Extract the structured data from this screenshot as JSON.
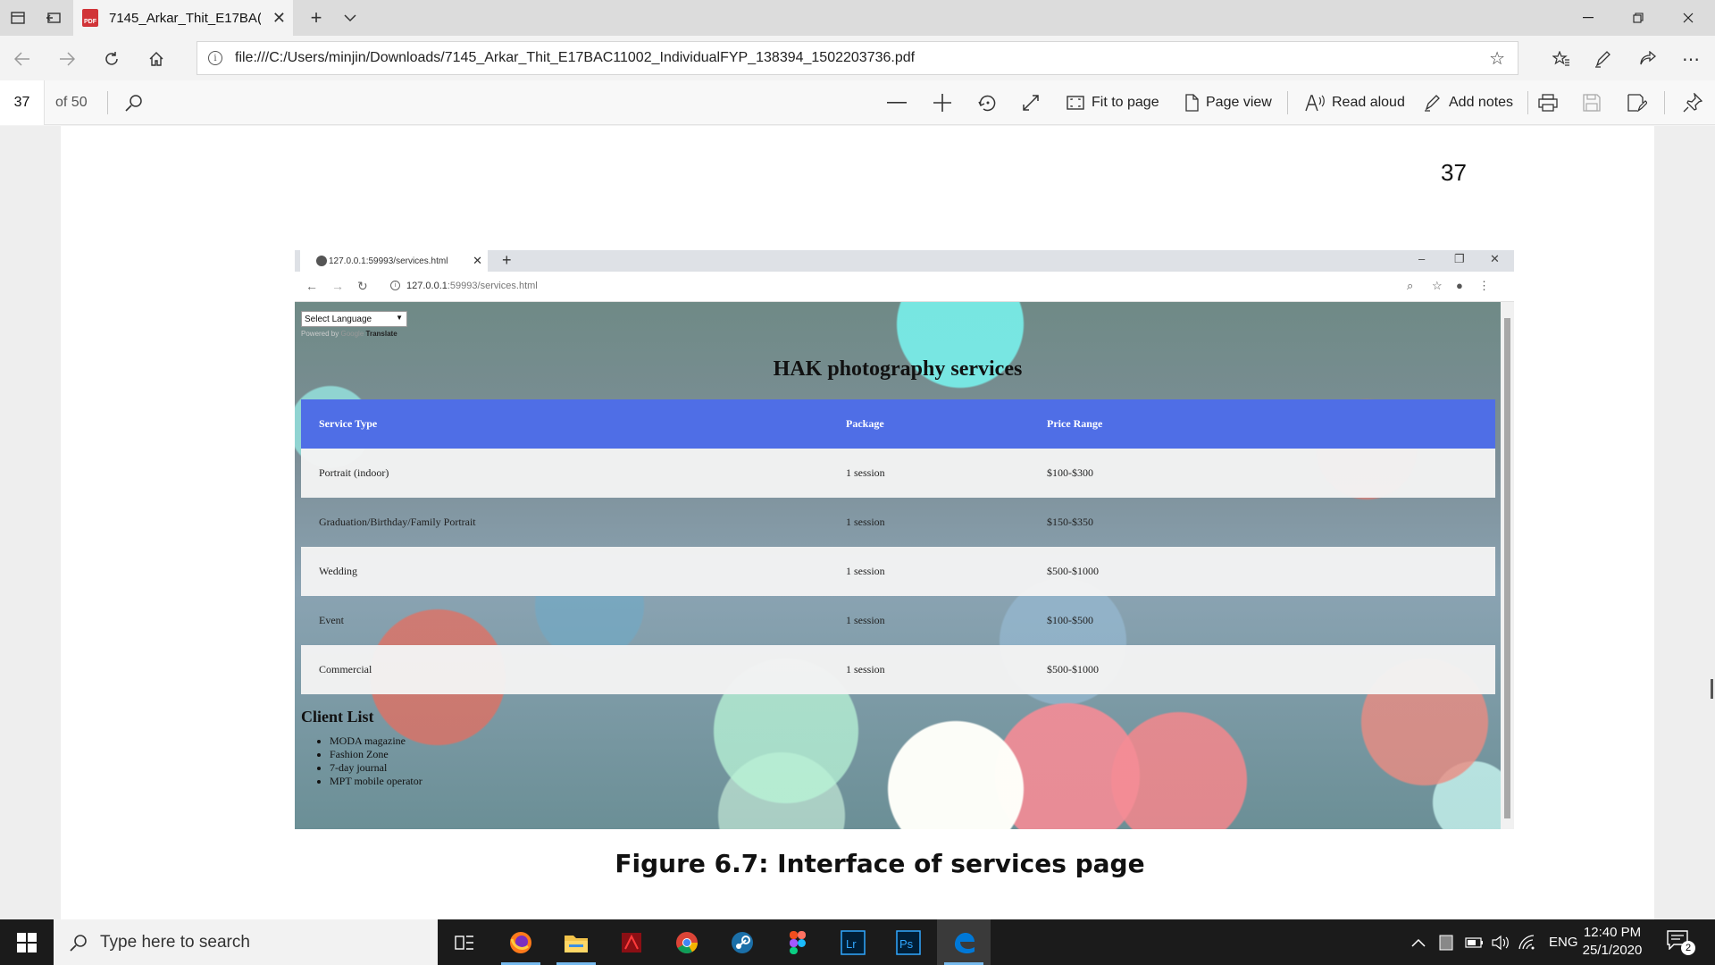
{
  "browser": {
    "tab_title": "7145_Arkar_Thit_E17BA(",
    "url": "file:///C:/Users/minjin/Downloads/7145_Arkar_Thit_E17BAC11002_IndividualFYP_138394_1502203736.pdf"
  },
  "pdf_toolbar": {
    "current_page": "37",
    "page_count": "of 50",
    "fit_to_page": "Fit to page",
    "page_view": "Page view",
    "read_aloud": "Read aloud",
    "add_notes": "Add notes"
  },
  "document": {
    "page_number": "37",
    "caption": "Figure 6.7: Interface of services page"
  },
  "screenshot": {
    "tab_title": "127.0.0.1:59993/services.html",
    "url_host": "127.0.0.1",
    "url_rest": ":59993/services.html",
    "language_select": "Select Language",
    "powered_by": "Powered by",
    "google": "Google",
    "translate": "Translate",
    "page_title": "HAK photography services",
    "table": {
      "headers": [
        "Service Type",
        "Package",
        "Price Range"
      ],
      "rows": [
        [
          "Portrait (indoor)",
          "1 session",
          "$100-$300"
        ],
        [
          "Graduation/Birthday/Family Portrait",
          "1 session",
          "$150-$350"
        ],
        [
          "Wedding",
          "1 session",
          "$500-$1000"
        ],
        [
          "Event",
          "1 session",
          "$100-$500"
        ],
        [
          "Commercial",
          "1 session",
          "$500-$1000"
        ]
      ]
    },
    "client_list_title": "Client List",
    "clients": [
      "MODA magazine",
      "Fashion Zone",
      "7-day journal",
      "MPT mobile operator"
    ]
  },
  "taskbar": {
    "search_placeholder": "Type here to search",
    "language": "ENG",
    "time": "12:40 PM",
    "date": "25/1/2020",
    "notification_count": "2"
  },
  "colors": {
    "table_header": "#4f6ee6",
    "edge_accent": "#0078d7"
  }
}
